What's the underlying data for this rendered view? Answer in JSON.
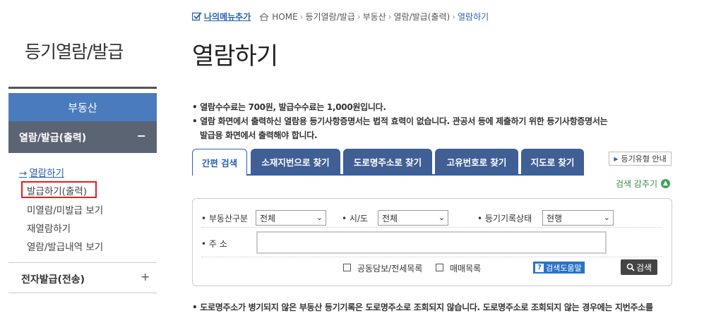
{
  "sidebar": {
    "title": "등기열람/발급",
    "header": "부동산",
    "category": "열람/발급(출력)",
    "category_sign": "−",
    "items": [
      {
        "arrow": "→",
        "label": "열람하기"
      },
      {
        "label": "발급하기(출력)"
      },
      {
        "label": "미열람/미발급 보기"
      },
      {
        "label": "재열람하기"
      },
      {
        "label": "열람/발급내역 보기"
      }
    ],
    "category2": "전자발급(전송)",
    "category2_sign": "+"
  },
  "breadcrumb": {
    "my_menu": "나의메뉴추가",
    "items": [
      "HOME",
      "등기열람/발급",
      "부동산",
      "열람/발급(출력)",
      "열람하기"
    ],
    "separator": "›"
  },
  "page_title": "열람하기",
  "notices": [
    "• 열람수수료는 700원, 발급수수료는 1,000원입니다.",
    "• 열람 화면에서 출력하신 열람용 등기사항증명서는 법적 효력이 없습니다. 관공서 등에 제출하기 위한 등기사항증명서는",
    "발급용 화면에서 출력해야 합니다."
  ],
  "tabs": [
    "간편 검색",
    "소재지번으로 찾기",
    "도로명주소로 찾기",
    "고유번호로 찾기",
    "지도로 찾기"
  ],
  "guide_button": "등기유형 안내",
  "fold_label": "검색 감추기",
  "form": {
    "property_type_label": "• 부동산구분",
    "property_type_value": "전체",
    "region_label": "• 시/도",
    "region_value": "전체",
    "record_status_label": "• 등기기록상태",
    "record_status_value": "현행",
    "address_label": "• 주 소",
    "address_value": "",
    "checkbox1": "공동담보/전세목록",
    "checkbox2": "매매목록",
    "help_button": "검색도움말",
    "search_button": "검색"
  },
  "bottom_note": "• 도로명주소가 병기되지 않은 부동산 등기기록은 도로명주소로 조회되지 않습니다. 도로명주소로 조회되지 않는 경우에는 지번주소를",
  "colors": {
    "accent": "#2a62b0",
    "sidebar_header": "#4a7cbd",
    "sidebar_category": "#5b6473",
    "highlight": "#e02020"
  }
}
